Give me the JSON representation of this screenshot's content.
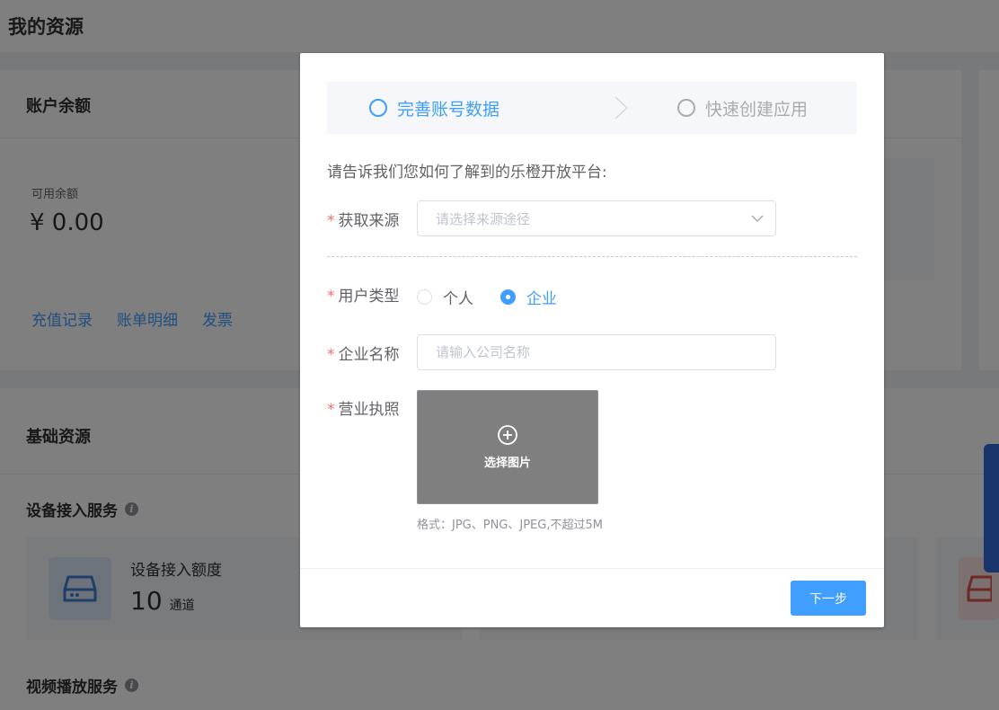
{
  "page": {
    "title": "我的资源"
  },
  "account": {
    "title": "账户余额",
    "balance_label": "可用余额",
    "balance_value": "¥ 0.00",
    "links": [
      "充值记录",
      "账单明细",
      "发票"
    ]
  },
  "base": {
    "title": "基础资源",
    "device_section_title": "设备接入服务",
    "device_quota_label": "设备接入额度",
    "device_quota_value": "10",
    "device_quota_unit": "通道",
    "video_section_title": "视频播放服务"
  },
  "dialog": {
    "steps": [
      "完善账号数据",
      "快速创建应用"
    ],
    "intro": "请告诉我们您如何了解到的乐橙开放平台:",
    "required_mark": "*",
    "source": {
      "label": "获取来源",
      "placeholder": "请选择来源途径"
    },
    "user_type": {
      "label": "用户类型",
      "options": [
        "个人",
        "企业"
      ],
      "selected": "企业"
    },
    "company_name": {
      "label": "企业名称",
      "placeholder": "请输入公司名称"
    },
    "license": {
      "label": "营业执照",
      "upload_text": "选择图片",
      "hint": "格式：JPG、PNG、JPEG,不超过5M"
    },
    "next_button": "下一步"
  },
  "colors": {
    "primary": "#409eff",
    "required": "#f56c6c",
    "scroll_tab": "#3268d6"
  },
  "icons": [
    "info-icon",
    "server-icon",
    "plus-circle-icon",
    "chevron-down-icon",
    "chevron-right-icon"
  ]
}
